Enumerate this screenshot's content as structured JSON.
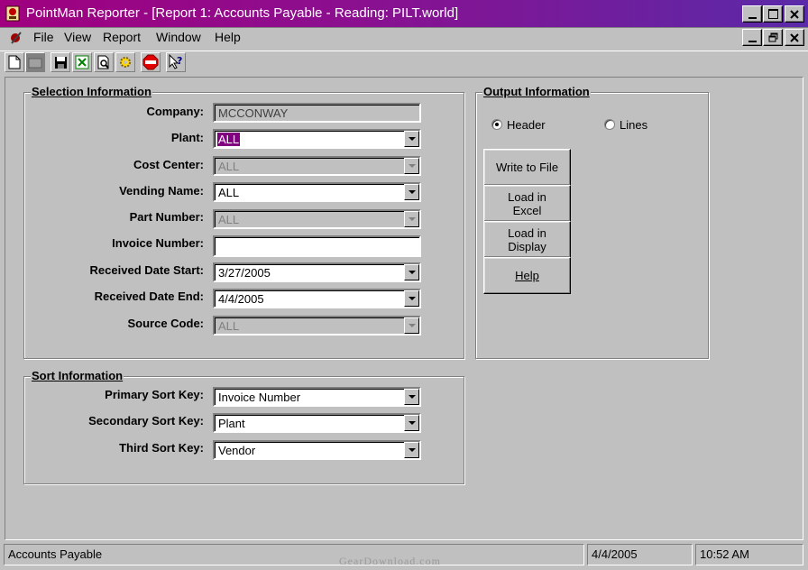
{
  "window": {
    "title": "PointMan Reporter - [Report 1: Accounts Payable - Reading: PILT.world]"
  },
  "menu": [
    "File",
    "View",
    "Report",
    "Window",
    "Help"
  ],
  "toolbar_icons": [
    "new-icon",
    "open-icon",
    "save-icon",
    "excel-icon",
    "print-preview-icon",
    "settings-icon",
    "stop-icon",
    "help-pointer-icon"
  ],
  "selection": {
    "title": "Selection Information",
    "company": {
      "label": "Company:",
      "value": "MCCONWAY"
    },
    "plant": {
      "label": "Plant:",
      "value": "ALL"
    },
    "cost_center": {
      "label": "Cost Center:",
      "value": "ALL"
    },
    "vending_name": {
      "label": "Vending Name:",
      "value": "ALL"
    },
    "part_number": {
      "label": "Part Number:",
      "value": "ALL"
    },
    "invoice_number": {
      "label": "Invoice Number:",
      "value": ""
    },
    "received_start": {
      "label": "Received Date Start:",
      "value": "3/27/2005"
    },
    "received_end": {
      "label": "Received Date End:",
      "value": "4/4/2005"
    },
    "source_code": {
      "label": "Source Code:",
      "value": "ALL"
    }
  },
  "output": {
    "title": "Output Information",
    "header_label": "Header",
    "lines_label": "Lines",
    "selected": "Header",
    "write_label": "Write to File",
    "excel_label_1": "Load in",
    "excel_label_2": "Excel",
    "display_label_1": "Load in",
    "display_label_2": "Display",
    "help_label": "Help"
  },
  "sort": {
    "title": "Sort Information",
    "primary": {
      "label": "Primary Sort Key:",
      "value": "Invoice Number"
    },
    "secondary": {
      "label": "Secondary Sort Key:",
      "value": "Plant"
    },
    "third": {
      "label": "Third Sort Key:",
      "value": "Vendor"
    }
  },
  "status": {
    "report": "Accounts Payable",
    "date": "4/4/2005",
    "time": "10:52 AM",
    "watermark": "GearDownload.com"
  },
  "colors": {
    "titlebar": "#a0007f",
    "selection_highlight": "#800080",
    "face": "#c0c0c0"
  }
}
